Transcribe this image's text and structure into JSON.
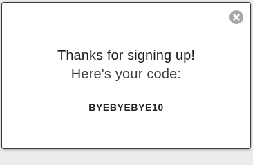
{
  "dialog": {
    "close_icon": "close-circle-icon",
    "heading": "Thanks for signing up!",
    "subheading": "Here's your code:",
    "code": "BYEBYEBYE10"
  },
  "colors": {
    "border": "#3a3a3a",
    "close_bg": "#a7a7a7",
    "text": "#1e1e1e"
  }
}
